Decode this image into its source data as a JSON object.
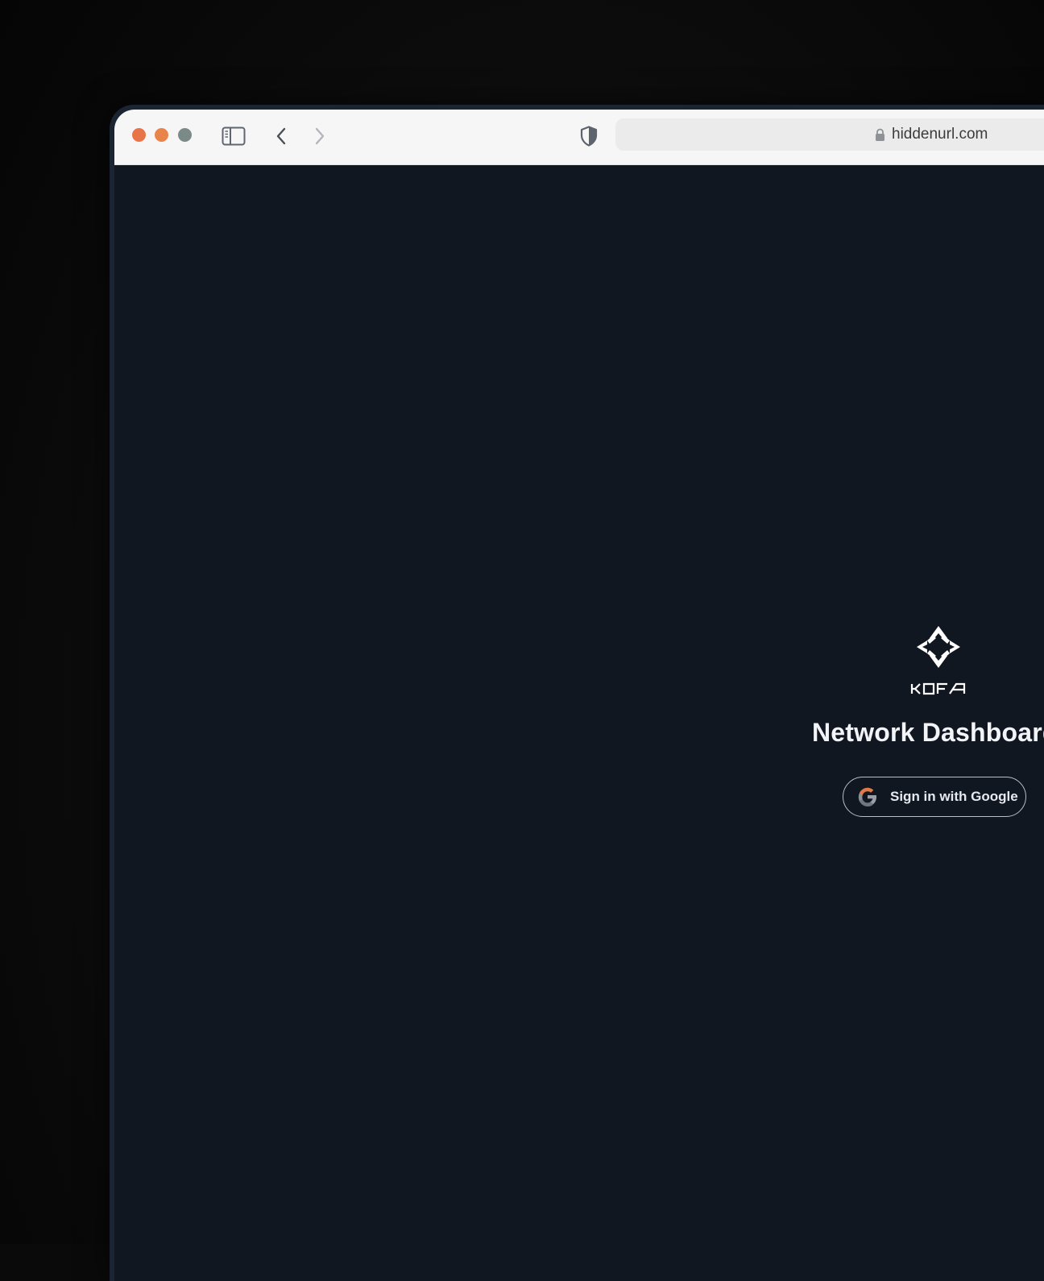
{
  "browser": {
    "url": "hiddenurl.com",
    "icons": {
      "close": "close-traffic-light",
      "minimize": "minimize-traffic-light",
      "maximize": "maximize-traffic-light",
      "sidebar": "sidebar-toggle-icon",
      "back": "chevron-left-icon",
      "forward": "chevron-right-icon",
      "privacy": "shield-icon",
      "lock": "lock-icon"
    },
    "colors": {
      "close": "#e8744a",
      "minimize": "#e8844a",
      "maximize": "#7b8a86",
      "toolbar": "#f6f6f6"
    }
  },
  "page": {
    "brand": "KOFA",
    "title": "Network Dashboard",
    "signin_label": "Sign in with Google",
    "background": "#111721"
  }
}
